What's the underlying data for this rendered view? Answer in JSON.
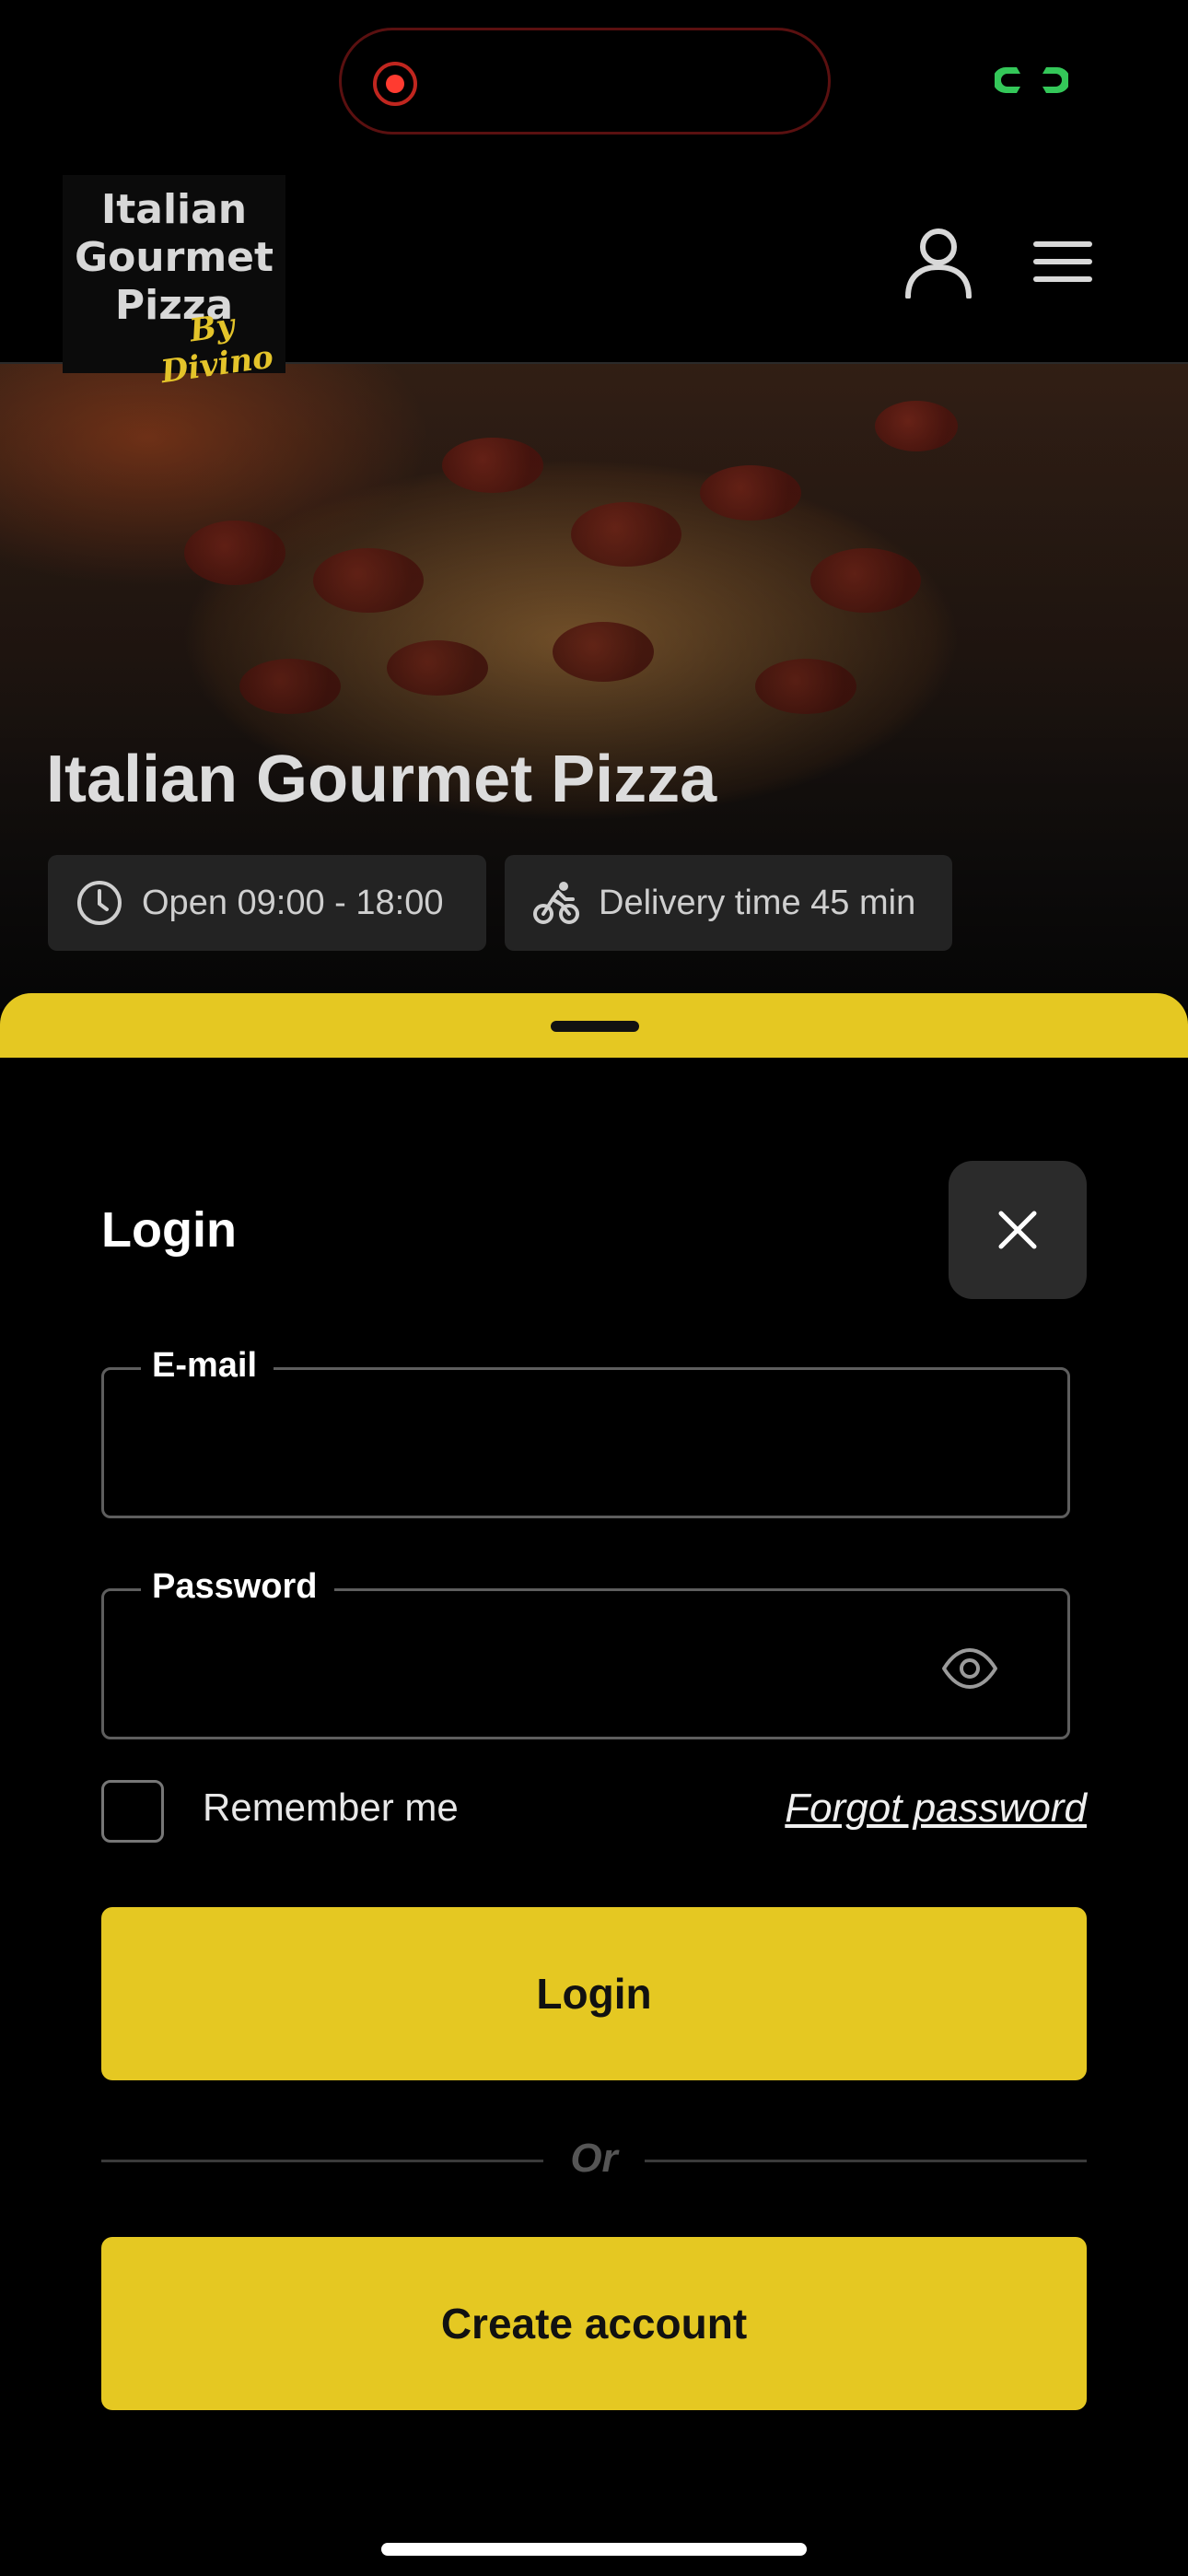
{
  "header": {
    "logo": {
      "lines": [
        "Italian",
        "Gourmet",
        "Pizza"
      ],
      "script": "By Divino"
    }
  },
  "hero": {
    "title": "Italian Gourmet Pizza",
    "hours": "Open 09:00 - 18:00",
    "delivery": "Delivery time 45 min"
  },
  "login": {
    "title": "Login",
    "email_label": "E-mail",
    "email_value": "",
    "password_label": "Password",
    "password_value": "",
    "remember_label": "Remember me",
    "remember_checked": false,
    "forgot_label": "Forgot password",
    "login_button": "Login",
    "divider": "Or",
    "create_button": "Create account"
  },
  "colors": {
    "accent": "#e5c822",
    "background": "#000000",
    "recording": "#ff3b30",
    "link_indicator": "#34c759"
  },
  "icons": {
    "status": [
      "recording-icon",
      "link-icon"
    ],
    "header": [
      "user-icon",
      "menu-icon"
    ],
    "hero": [
      "clock-icon",
      "bicycle-icon"
    ],
    "sheet": [
      "close-icon",
      "eye-icon"
    ]
  }
}
